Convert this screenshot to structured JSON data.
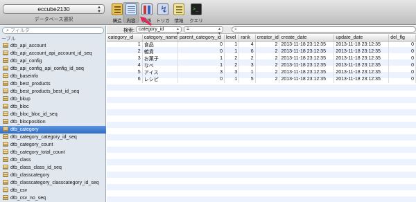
{
  "toolbar": {
    "database": "eccube2130",
    "database_caption": "データベース選択",
    "tools": [
      {
        "label": "構造",
        "icon": "structure-icon"
      },
      {
        "label": "内容",
        "icon": "table-content-icon"
      },
      {
        "label": "関係",
        "icon": "relations-icon"
      },
      {
        "label": "トリガ",
        "icon": "triggers-icon"
      },
      {
        "label": "情報",
        "icon": "info-icon"
      },
      {
        "label": "クエリ",
        "icon": "query-terminal-icon"
      }
    ],
    "accent": "#e8245a"
  },
  "sidebar": {
    "filter_placeholder": "フィルタ",
    "section_label": "ーブル",
    "tables": [
      "dtb_api_account",
      "dtb_api_account_api_account_id_seq",
      "dtb_api_config",
      "dtb_api_config_api_config_id_seq",
      "dtb_baseinfo",
      "dtb_best_products",
      "dtb_best_products_best_id_seq",
      "dtb_bkup",
      "dtb_bloc",
      "dtb_bloc_bloc_id_seq",
      "dtb_blocposition",
      "dtb_category",
      "dtb_category_category_id_seq",
      "dtb_category_count",
      "dtb_category_total_count",
      "dtb_class",
      "dtb_class_class_id_seq",
      "dtb_classcategory",
      "dtb_classcategory_classcategory_id_seq",
      "dtb_csv",
      "dtb_csv_no_seq",
      "dtb_csv_sql"
    ],
    "selected": "dtb_category",
    "selection_color": "#3a78cf"
  },
  "filterbar": {
    "label": "検索:",
    "column": "category_id",
    "operator": "=",
    "search_placeholder": ""
  },
  "grid": {
    "columns": [
      "category_id",
      "category_name",
      "parent_category_id",
      "level",
      "rank",
      "creator_id",
      "create_date",
      "update_date",
      "del_flg"
    ],
    "rows": [
      [
        "1",
        "食品",
        "0",
        "1",
        "4",
        "2",
        "2013-11-18 23:12:35",
        "2013-11-18 23:12:35",
        "0"
      ],
      [
        "2",
        "雑貨",
        "0",
        "1",
        "6",
        "2",
        "2013-11-18 23:12:35",
        "2013-11-18 23:12:35",
        "0"
      ],
      [
        "3",
        "お菓子",
        "1",
        "2",
        "2",
        "2",
        "2013-11-18 23:12:35",
        "2013-11-18 23:12:35",
        "0"
      ],
      [
        "4",
        "なべ",
        "1",
        "2",
        "3",
        "2",
        "2013-11-18 23:12:35",
        "2013-11-18 23:12:35",
        "0"
      ],
      [
        "5",
        "アイス",
        "3",
        "3",
        "1",
        "2",
        "2013-11-18 23:12:35",
        "2013-11-18 23:12:35",
        "0"
      ],
      [
        "6",
        "レシピ",
        "0",
        "1",
        "5",
        "2",
        "2013-11-18 23:12:35",
        "2013-11-18 23:12:35",
        "0"
      ]
    ]
  }
}
